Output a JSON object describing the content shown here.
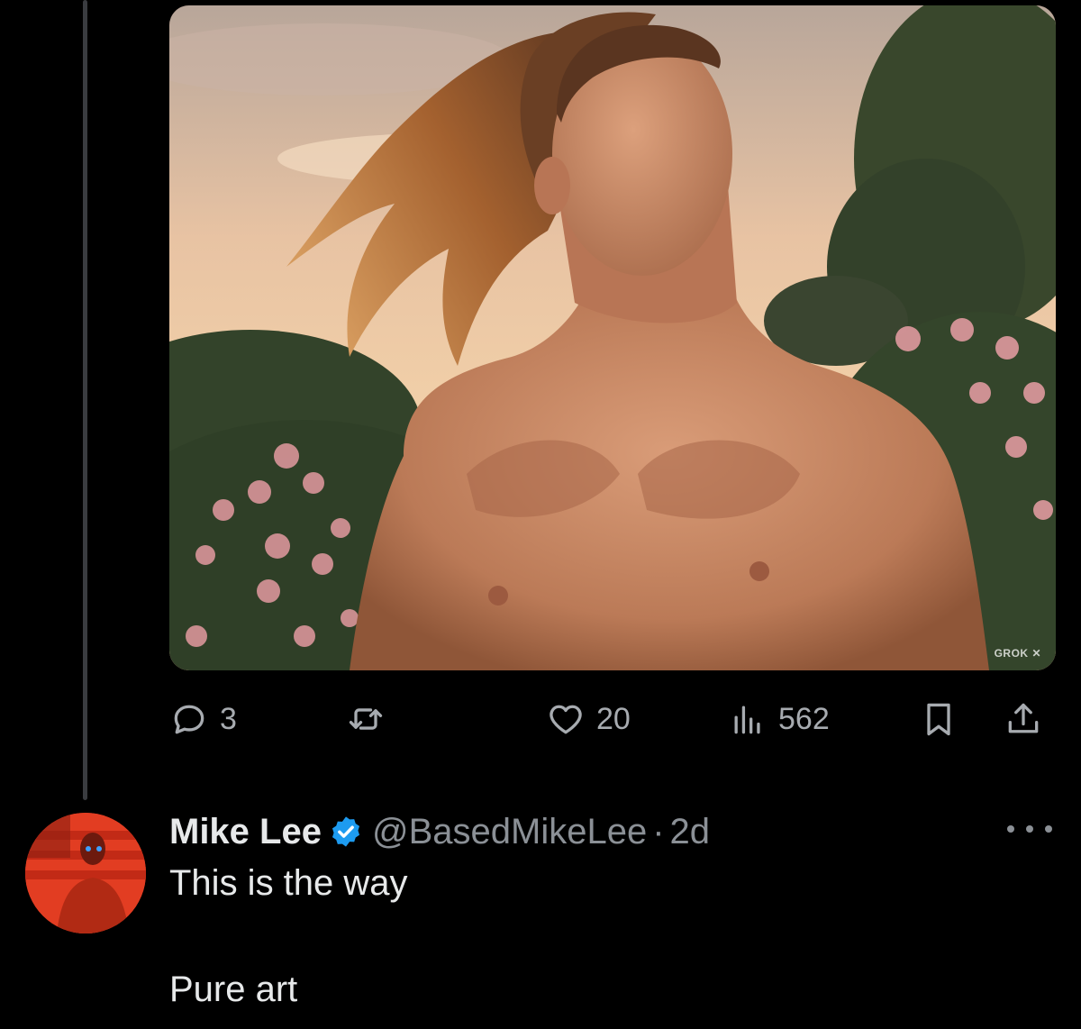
{
  "media": {
    "watermark": "GROK",
    "watermark_logo": "xai-logo-icon"
  },
  "actions": {
    "reply_count": "3",
    "retweet_count": "",
    "like_count": "20",
    "views_count": "562",
    "icons": [
      "reply-icon",
      "retweet-icon",
      "heart-icon",
      "views-icon",
      "bookmark-icon",
      "share-icon"
    ]
  },
  "reply": {
    "name": "Mike Lee",
    "handle": "@BasedMikeLee",
    "separator": "·",
    "time": "2d",
    "lines": [
      "This is the way",
      "Pure art"
    ]
  },
  "colors": {
    "background": "#000000",
    "text": "#e7e9ea",
    "muted": "#8b9096",
    "verified": "#1d9bf0"
  }
}
